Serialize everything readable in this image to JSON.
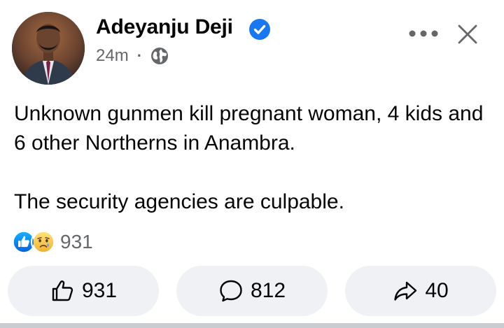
{
  "post": {
    "author": "Adeyanju Deji",
    "verified": true,
    "time": "24m",
    "separator": "·",
    "audience_icon": "globe-icon",
    "text_line_1": "Unknown gunmen kill pregnant woman, 4 kids and 6 other Northerns in Anambra.",
    "text_line_2": "The security agencies are culpable."
  },
  "reactions": {
    "icons": [
      "like-reaction-icon",
      "sad-reaction-icon"
    ],
    "count": "931"
  },
  "actions": {
    "like_count": "931",
    "comment_count": "812",
    "share_count": "40"
  },
  "colors": {
    "verified_blue": "#1877f2",
    "secondary_text": "#65676b",
    "button_bg": "#eff1f4",
    "sad_yellow": "#f7c542"
  }
}
